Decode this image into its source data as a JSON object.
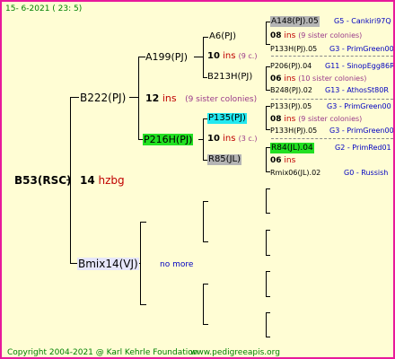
{
  "header": {
    "date": "15-  6-2021 (  23:  5)"
  },
  "footer": {
    "copyright": "Copyright 2004-2021 @ Karl Kehrle Foundation",
    "website": "www.pedigreeapis.org"
  },
  "root": {
    "name": "B53(RSC)",
    "count": "14",
    "suffix": "hzbg"
  },
  "dam": {
    "name": "B222(PJ)",
    "count": "12",
    "ins": "ins",
    "sisters": "(9 sister colonies)",
    "dam": {
      "name": "A199(PJ)",
      "dam": {
        "name": "A6(PJ)",
        "count": "10",
        "ins": "ins",
        "sisters": "(9 c.)"
      },
      "sire": {
        "name": "B213H(PJ)"
      }
    },
    "sire": {
      "name": "P216H(PJ)",
      "count": "10",
      "ins": "ins",
      "sisters": "(3 c.)",
      "dam": {
        "name": "P135(PJ)"
      },
      "sire": {
        "name": "R85(JL)"
      }
    }
  },
  "sire": {
    "name": "Bmix14(VJ)",
    "note": "no more"
  },
  "gen5": [
    {
      "name": "A148(PJ).05",
      "right": "G5 - Cankiri97Q"
    },
    {
      "count": "08",
      "ins": "ins",
      "sisters": "(9 sister colonies)"
    },
    {
      "name": "P133H(PJ).05",
      "right": "G3 - PrimGreen00"
    },
    {
      "name": "P206(PJ).04",
      "right": "G11 - SinopEgg86R"
    },
    {
      "count": "06",
      "ins": "ins",
      "sisters": "(10 sister colonies)"
    },
    {
      "name": "B248(PJ).02",
      "right": "G13 - AthosSt80R"
    },
    {
      "name": "P133(PJ).05",
      "right": "G3 - PrimGreen00"
    },
    {
      "count": "08",
      "ins": "ins",
      "sisters": "(9 sister colonies)"
    },
    {
      "name": "P133H(PJ).05",
      "right": "G3 - PrimGreen00"
    },
    {
      "name": "R84(JL).04",
      "right": "G2 - PrimRed01"
    },
    {
      "count": "06",
      "ins": "ins"
    },
    {
      "name": "Rmix06(JL).02",
      "right": "G0 - Russish"
    }
  ],
  "colors": {
    "border": "#e8199b",
    "background": "#fffdd4",
    "green": "#22e022",
    "cyan": "#22e8f0",
    "grey": "#b4b4b4",
    "ins": "#c00000",
    "blue": "#0000c0"
  }
}
